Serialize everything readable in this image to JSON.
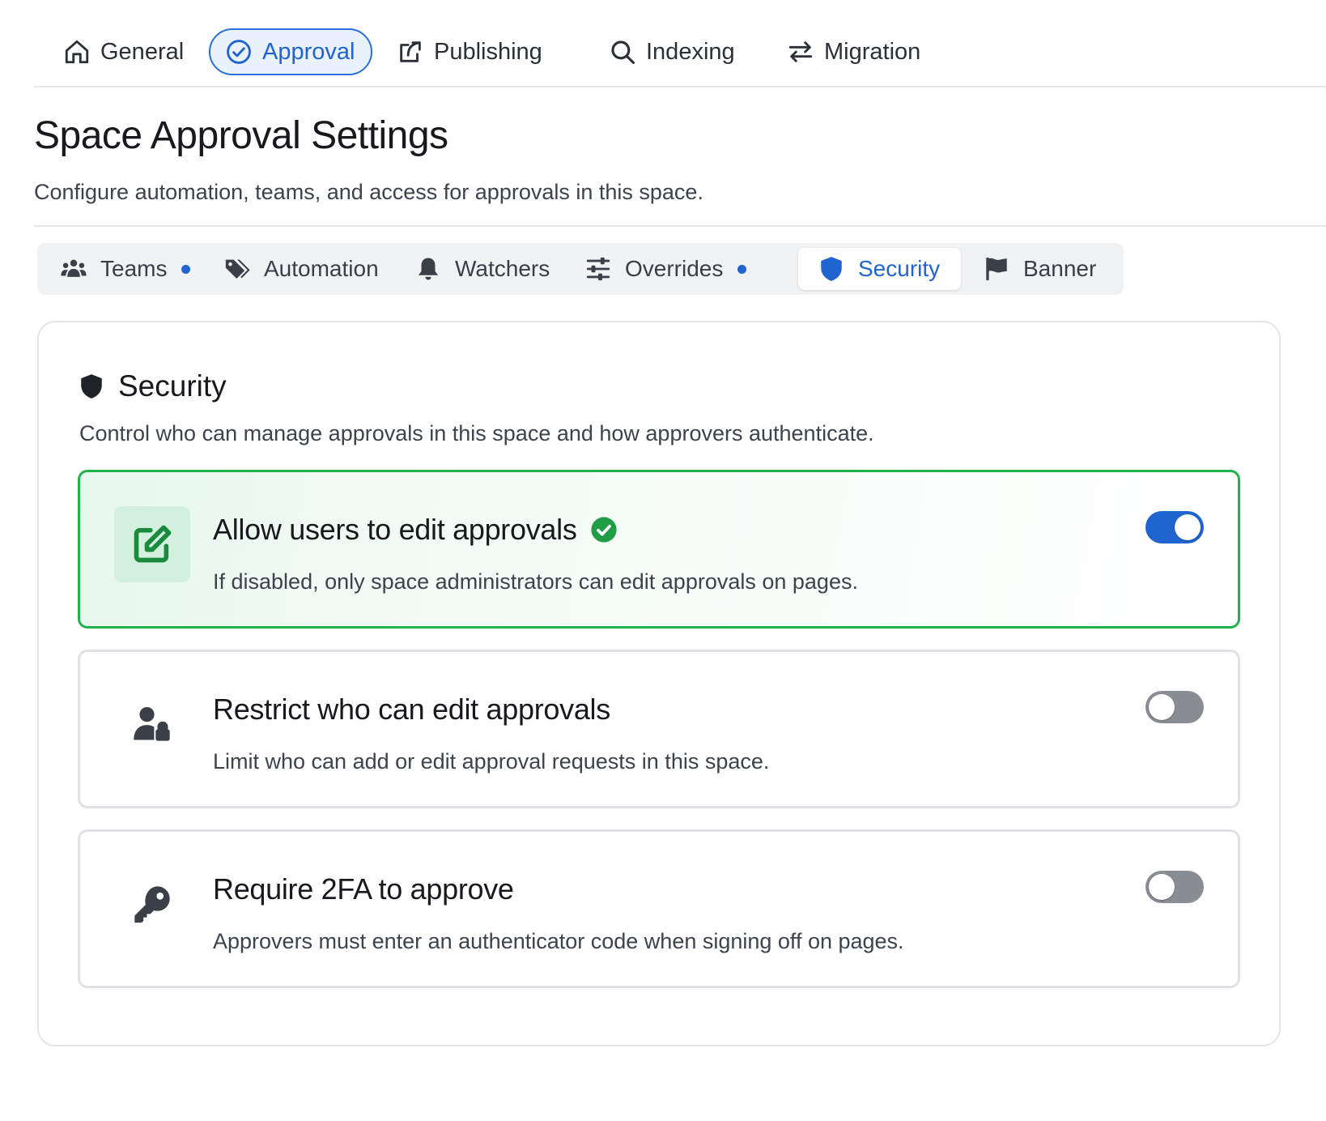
{
  "topnav": {
    "items": [
      {
        "label": "General",
        "icon": "home-icon"
      },
      {
        "label": "Approval",
        "icon": "check-circle-icon",
        "active": true
      },
      {
        "label": "Publishing",
        "icon": "share-icon"
      },
      {
        "label": "Indexing",
        "icon": "search-icon"
      },
      {
        "label": "Migration",
        "icon": "swap-arrows-icon"
      }
    ]
  },
  "page": {
    "title": "Space Approval Settings",
    "subtitle": "Configure automation, teams, and access for approvals in this space."
  },
  "subtabs": {
    "items": [
      {
        "label": "Teams",
        "icon": "users-icon",
        "dot": true
      },
      {
        "label": "Automation",
        "icon": "tags-icon"
      },
      {
        "label": "Watchers",
        "icon": "bell-icon"
      },
      {
        "label": "Overrides",
        "icon": "sliders-icon",
        "dot": true
      },
      {
        "label": "Security",
        "icon": "shield-icon",
        "active": true
      },
      {
        "label": "Banner",
        "icon": "flag-icon"
      }
    ]
  },
  "security": {
    "title": "Security",
    "subtitle": "Control who can manage approvals in this space and how approvers authenticate.",
    "options": [
      {
        "title": "Allow users to edit approvals",
        "description": "If disabled, only space administrators can edit approvals on pages.",
        "enabled": true,
        "icon": "edit-square-icon",
        "verified_icon": "check-badge-icon"
      },
      {
        "title": "Restrict who can edit approvals",
        "description": "Limit who can add or edit approval requests in this space.",
        "enabled": false,
        "icon": "user-lock-icon"
      },
      {
        "title": "Require 2FA to approve",
        "description": "Approvers must enter an authenticator code when signing off on pages.",
        "enabled": false,
        "icon": "key-icon"
      }
    ]
  },
  "colors": {
    "accent": "#1f64cf",
    "success": "#22b24c",
    "toggle_off": "#8a8d93"
  }
}
